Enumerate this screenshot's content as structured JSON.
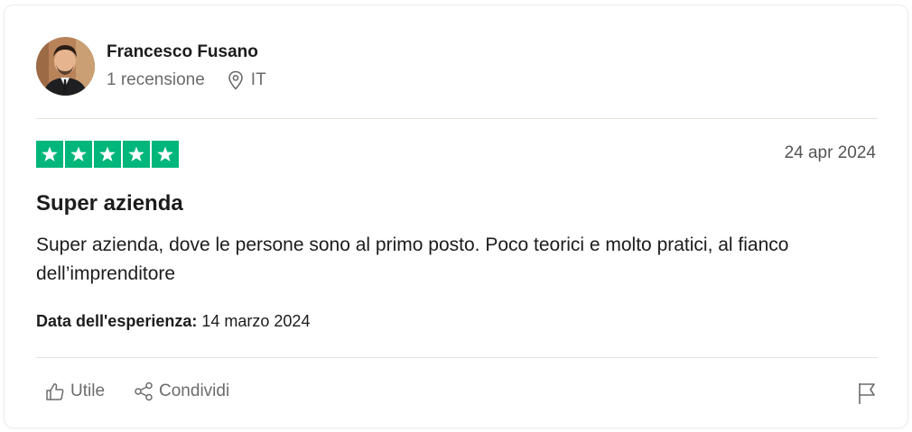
{
  "author": {
    "name": "Francesco Fusano",
    "reviews_count": "1 recensione",
    "country": "IT"
  },
  "review": {
    "rating": 5,
    "date": "24 apr 2024",
    "title": "Super azienda",
    "body": "Super azienda, dove le persone sono al primo posto. Poco teorici e molto pratici, al fianco dell’imprenditore",
    "experience_label": "Data dell'esperienza:",
    "experience_date": "14 marzo 2024"
  },
  "actions": {
    "useful_label": "Utile",
    "share_label": "Condividi"
  },
  "colors": {
    "star_green": "#00b67a",
    "muted_text": "#6b6b6b"
  },
  "icons": [
    "location-pin-icon",
    "star-icon",
    "thumbs-up-icon",
    "share-icon",
    "flag-icon"
  ]
}
